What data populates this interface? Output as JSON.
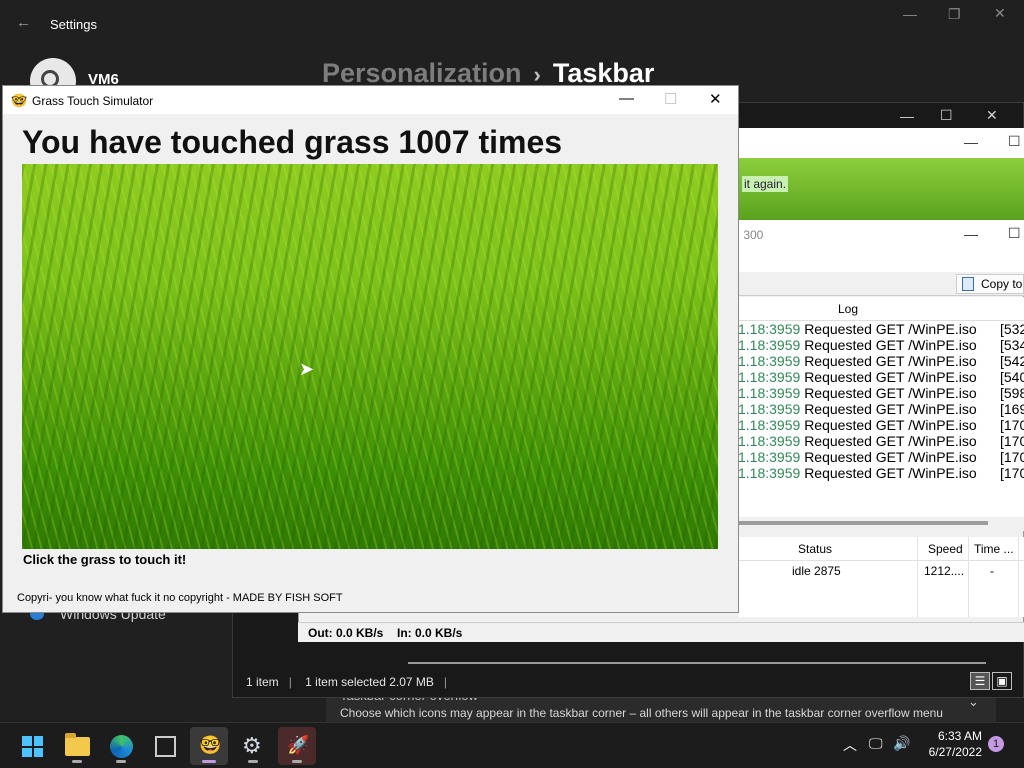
{
  "settings": {
    "title": "Settings",
    "back_icon": "←",
    "user_name": "VM6",
    "breadcrumb_parent": "Personalization",
    "breadcrumb_sep": "›",
    "breadcrumb_current": "Taskbar",
    "sidebar_item": "Windows Update",
    "section_title": "Taskbar corner overflow",
    "section_desc": "Choose which icons may appear in the taskbar corner – all others will appear in the taskbar corner overflow menu",
    "chevron": "⌄"
  },
  "explorer": {
    "status_items": "1 item",
    "status_selected": "1 item selected  2.07 MB"
  },
  "hfs": {
    "banner_text": "it again.",
    "subwindow_text": "̀ 300",
    "copy_button": "Copy to",
    "log_header": "Log",
    "log": [
      {
        "time": "1.18:3959",
        "msg": "Requested GET /WinPE.iso",
        "tail": "[532"
      },
      {
        "time": "1.18:3959",
        "msg": "Requested GET /WinPE.iso",
        "tail": "[534"
      },
      {
        "time": "1.18:3959",
        "msg": "Requested GET /WinPE.iso",
        "tail": "[542"
      },
      {
        "time": "1.18:3959",
        "msg": "Requested GET /WinPE.iso",
        "tail": "[540"
      },
      {
        "time": "1.18:3959",
        "msg": "Requested GET /WinPE.iso",
        "tail": "[598"
      },
      {
        "time": "1.18:3959",
        "msg": "Requested GET /WinPE.iso",
        "tail": "[169"
      },
      {
        "time": "1.18:3959",
        "msg": "Requested GET /WinPE.iso",
        "tail": "[170"
      },
      {
        "time": "1.18:3959",
        "msg": "Requested GET /WinPE.iso",
        "tail": "[170"
      },
      {
        "time": "1.18:3959",
        "msg": "Requested GET /WinPE.iso",
        "tail": "[170"
      },
      {
        "time": "1.18:3959",
        "msg": "Requested GET /WinPE.iso",
        "tail": "[170"
      }
    ],
    "columns": {
      "status": "Status",
      "speed": "Speed",
      "time": "Time ..."
    },
    "row": {
      "status": "idle 2875",
      "speed": "1212....",
      "time": "-"
    },
    "out": "Out: 0.0 KB/s",
    "in": "In: 0.0 KB/s"
  },
  "gts": {
    "title": "Grass Touch Simulator",
    "icon": "🤓",
    "heading": "You have touched grass 1007 times",
    "instruction": "Click the grass to touch it!",
    "copyright": "Copyri- you know what fuck it no copyright - MADE BY FISH SOFT"
  },
  "taskbar": {
    "time": "6:33 AM",
    "date": "6/27/2022",
    "notifications": "1",
    "apps": [
      "start-icon",
      "file-explorer-icon",
      "edge-icon",
      "vm-icon",
      "grass-simulator-icon",
      "settings-icon",
      "hfs-icon"
    ]
  },
  "colors": {
    "accent": "#c29adf",
    "log_time": "#2e8b57",
    "start_blue": "#4cc2ff"
  }
}
